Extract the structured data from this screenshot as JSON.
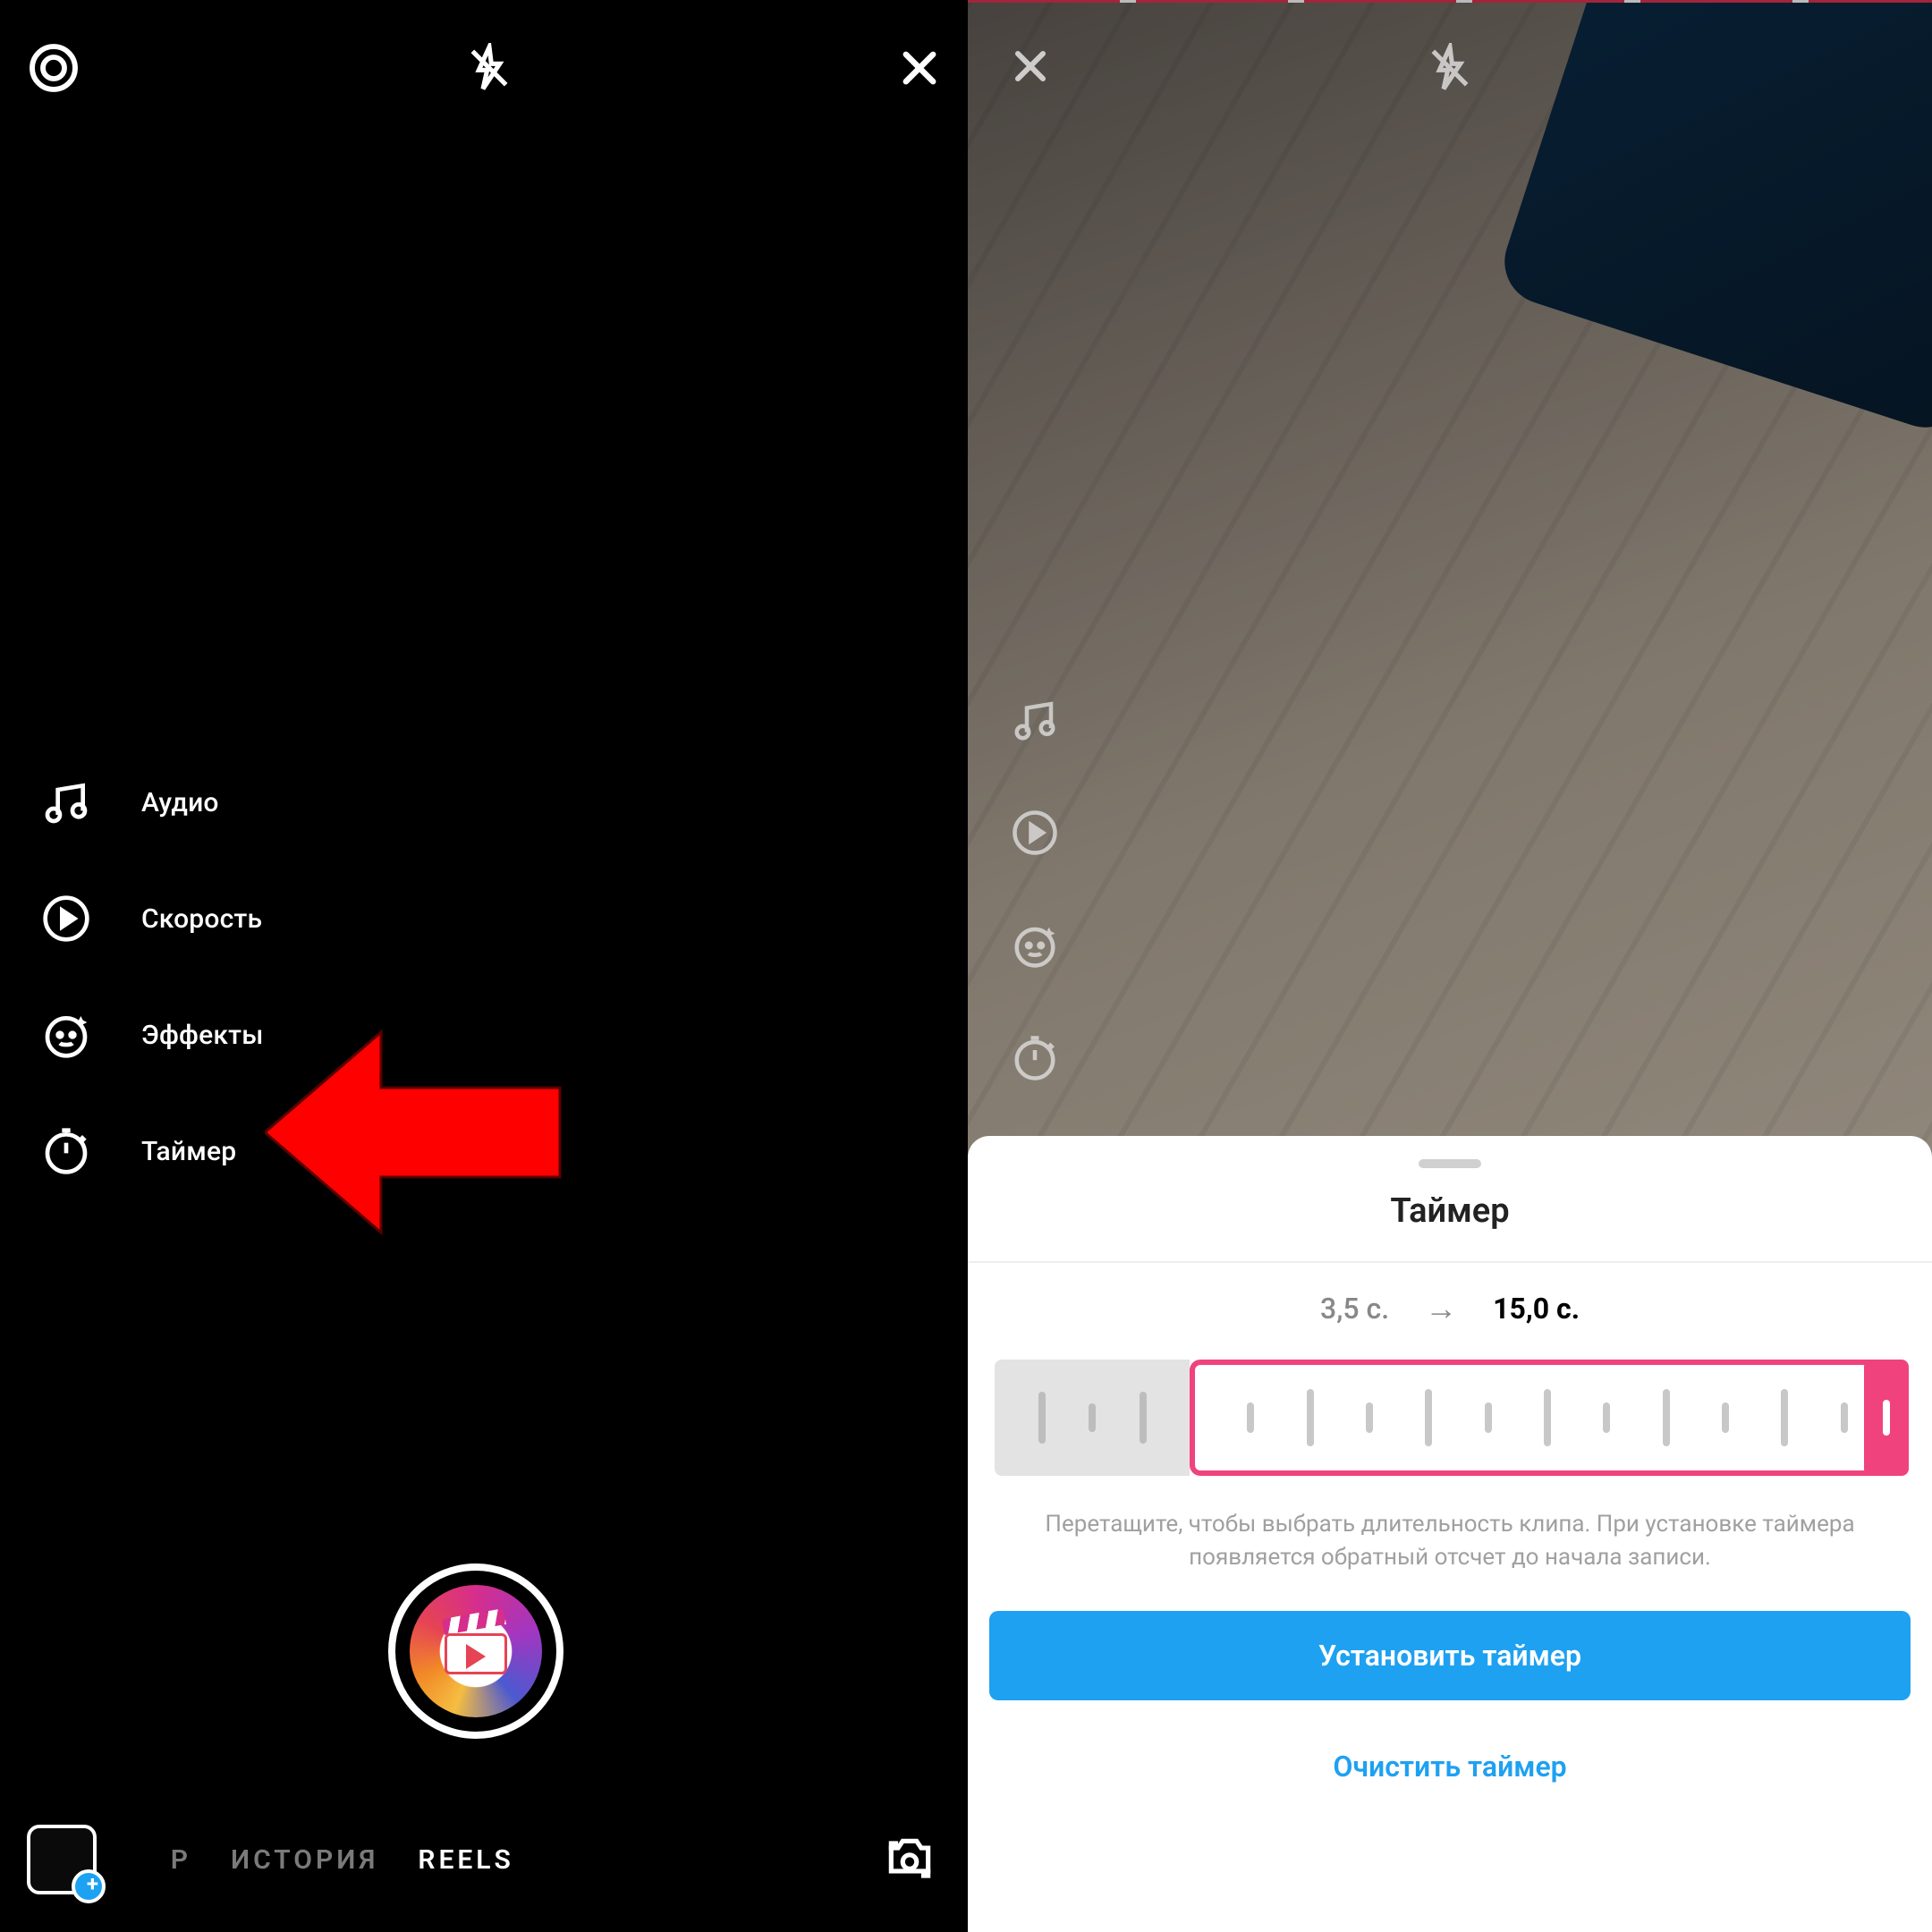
{
  "left": {
    "side_items": [
      {
        "id": "audio",
        "label": "Аудио"
      },
      {
        "id": "speed",
        "label": "Скорость"
      },
      {
        "id": "effects",
        "label": "Эффекты"
      },
      {
        "id": "timer",
        "label": "Таймер"
      }
    ],
    "modes": {
      "clipped": "Р",
      "history": "ИСТОРИЯ",
      "reels": "REELS"
    }
  },
  "right": {
    "sheet_title": "Таймер",
    "from_time": "3,5 с.",
    "arrow": "→",
    "to_time": "15,0 с.",
    "hint": "Перетащите, чтобы выбрать длительность клипа. При установке таймера появляется обратный отсчет до начала записи.",
    "set_button": "Установить таймер",
    "clear_button": "Очистить таймер"
  },
  "colors": {
    "accent_pink": "#f0437e",
    "accent_blue": "#1ea1f1",
    "arrow_red": "#ff0000"
  }
}
